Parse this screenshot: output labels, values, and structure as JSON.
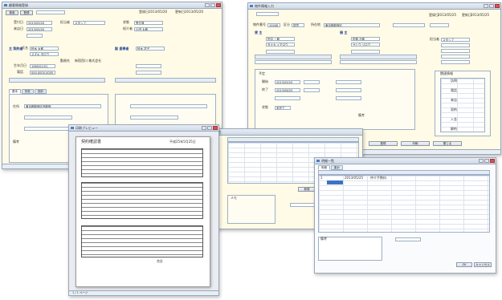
{
  "windows": {
    "w1": {
      "title": "顧客情報登録",
      "date_label": "登録日",
      "date_value": "2013/05/20",
      "update_label": "更新日",
      "update_value": "2013/05/20",
      "row1": [
        "受付日",
        "2013/05/20",
        "担当者",
        "スタッフ",
        "状態",
        "受付済"
      ],
      "row2": [
        "来店日",
        "2013/05/20",
        "紹介者",
        "山田 太郎"
      ],
      "section_main": "主 契約者",
      "section_sub": "副 連帯者",
      "name_label": "氏名",
      "name_value": "鈴木 太郎",
      "name_value2": "鈴木 花子",
      "kana_value": "スズキ タロウ",
      "birth_label": "生年月日",
      "birth_value": "1965/01/01",
      "tel_label": "電話",
      "tel_value": "000-0000-0000",
      "job_label": "勤務先",
      "job_value": "新宿西口 株式会社",
      "save_btn": "登録",
      "search_btn": "検索",
      "tabs": [
        "基本",
        "物件",
        "契約"
      ],
      "addr_label": "住所",
      "addr_value": "東京都新宿区西新宿",
      "note_label": "備考"
    },
    "w2": {
      "title": "物件情報入力",
      "date_label": "登録日",
      "date_value": "2013/05/25",
      "update_label": "更新日",
      "update_value": "2013/05/25",
      "row1": [
        "物件番号",
        "10008",
        "区分",
        "賃貸",
        "所在地",
        "東京都新宿区"
      ],
      "section_owner": "貸 主",
      "owner_name": "田中 一郎",
      "owner_kana": "タナカ イチロウ",
      "section_tenant": "借 主",
      "tenant_name": "佐藤 次郎",
      "tenant_kana": "サトウ ジロウ",
      "staff_label": "担当者",
      "staff_value": "スタッフ",
      "schedule_title": "予定",
      "start_label": "開始",
      "start_value": "2013/05/25",
      "end_label": "終了",
      "end_value": "2013/06/25",
      "status_label": "状態",
      "status_value": "未完了",
      "side_title": "関連情報",
      "side_items": [
        "訪問",
        "電話",
        "来店",
        "契約",
        "入金",
        "解約"
      ],
      "buttons": [
        "登録",
        "印刷",
        "閉じる"
      ],
      "memo_label": "備考"
    },
    "w3": {
      "title": "印刷プレビュー",
      "doc_title": "契約確認書",
      "doc_date": "平成25年5月25日",
      "col_heads": [
        "項目",
        "内容",
        "金額",
        "備考"
      ],
      "total_label": "合計",
      "footer": "1 / 1 ページ"
    },
    "w4": {
      "title": "取引一覧",
      "headers": [
        "日付",
        "区分",
        "内容",
        "金額",
        "状態"
      ],
      "buttons": [
        "新規",
        "編集",
        "削除"
      ],
      "memo_label": "メモ"
    },
    "w5": {
      "title": "明細一覧",
      "tab_on": "明細",
      "tab_off": "集計",
      "headers": [
        "No",
        "日付",
        "品目",
        "数量",
        "単価",
        "金額",
        "備考"
      ],
      "first_row": [
        "1",
        "2013/05/25",
        "仲介手数料"
      ],
      "memo_label": "備考",
      "ok_btn": "OK",
      "cancel_btn": "キャンセル"
    }
  }
}
